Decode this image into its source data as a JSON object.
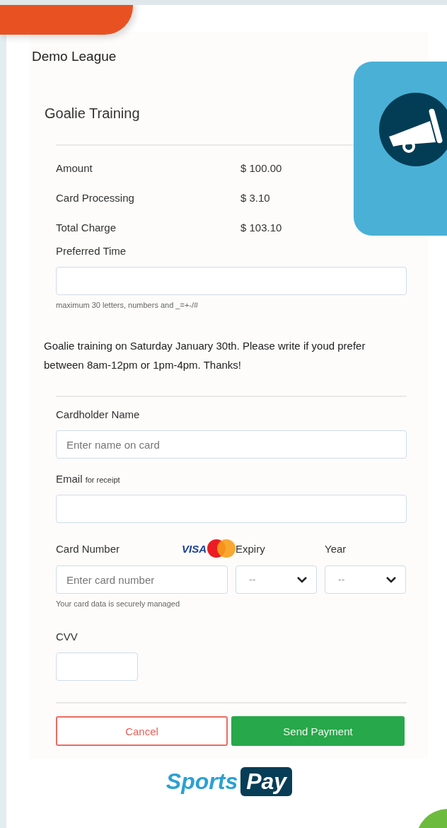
{
  "organization": "Demo League",
  "event": {
    "title": "Goalie Training"
  },
  "charges": [
    {
      "label": "Amount",
      "value": "$ 100.00"
    },
    {
      "label": "Card Processing",
      "value": "$ 3.10"
    },
    {
      "label": "Total Charge",
      "value": "$ 103.10"
    }
  ],
  "preferred_time": {
    "label": "Preferred Time",
    "hint": "maximum 30 letters, numbers and _=+-/#"
  },
  "description": "Goalie training on Saturday January 30th. Please write if youd prefer between 8am-12pm or 1pm-4pm. Thanks!",
  "cardholder": {
    "label": "Cardholder Name",
    "placeholder": "Enter name on card"
  },
  "email": {
    "label": "Email",
    "note": "for receipt"
  },
  "card_number": {
    "label": "Card Number",
    "brand": "VISA",
    "placeholder": "Enter card number",
    "hint": "Your card data is securely managed"
  },
  "expiry": {
    "label": "Expiry",
    "placeholder": "--"
  },
  "year": {
    "label": "Year",
    "placeholder": "--"
  },
  "cvv": {
    "label": "CVV"
  },
  "buttons": {
    "cancel": "Cancel",
    "submit": "Send Payment"
  },
  "footer_logo": {
    "word_1": "Sports",
    "word_2": "Pay"
  }
}
